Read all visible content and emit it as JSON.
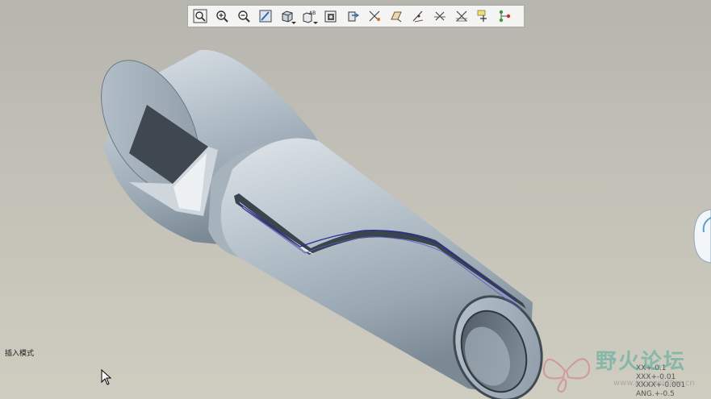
{
  "toolbar": {
    "buttons": [
      {
        "name": "zoom-fit",
        "icon": "zoom-fit-icon"
      },
      {
        "name": "zoom-in",
        "icon": "zoom-in-icon"
      },
      {
        "name": "zoom-out",
        "icon": "zoom-out-icon"
      },
      {
        "name": "repaint",
        "icon": "repaint-icon"
      },
      {
        "name": "display-style",
        "icon": "shaded-box-icon",
        "dropdown": true
      },
      {
        "name": "saved-views",
        "icon": "saved-views-icon",
        "label": "AB",
        "dropdown": true
      },
      {
        "name": "layers",
        "icon": "layers-icon"
      },
      {
        "name": "view-manager",
        "icon": "view-manager-icon"
      },
      {
        "name": "datum-planes",
        "icon": "datum-planes-icon"
      },
      {
        "name": "datum-axes",
        "icon": "datum-axes-icon"
      },
      {
        "name": "datum-points",
        "icon": "datum-points-icon"
      },
      {
        "name": "csys",
        "icon": "csys-icon"
      },
      {
        "name": "annotations",
        "icon": "annotation-icon"
      },
      {
        "name": "spin-center",
        "icon": "spin-center-icon"
      },
      {
        "name": "model-tree",
        "icon": "model-tree-icon"
      }
    ]
  },
  "status": {
    "text": "插入模式"
  },
  "tolerance": {
    "lines": [
      "XX+-0.1",
      "XXX+-0.01",
      "XXXX+-0.001",
      "ANG.+-0.5"
    ]
  },
  "watermark": {
    "text": "野火论坛",
    "url": "www.proewildfire.cn"
  },
  "colors": {
    "model_light": "#c9d2d9",
    "model_mid": "#98a7b3",
    "model_dark": "#5d6a74",
    "curve": "#2a2aa0",
    "toolbar_bg": "#f4f4f2"
  }
}
